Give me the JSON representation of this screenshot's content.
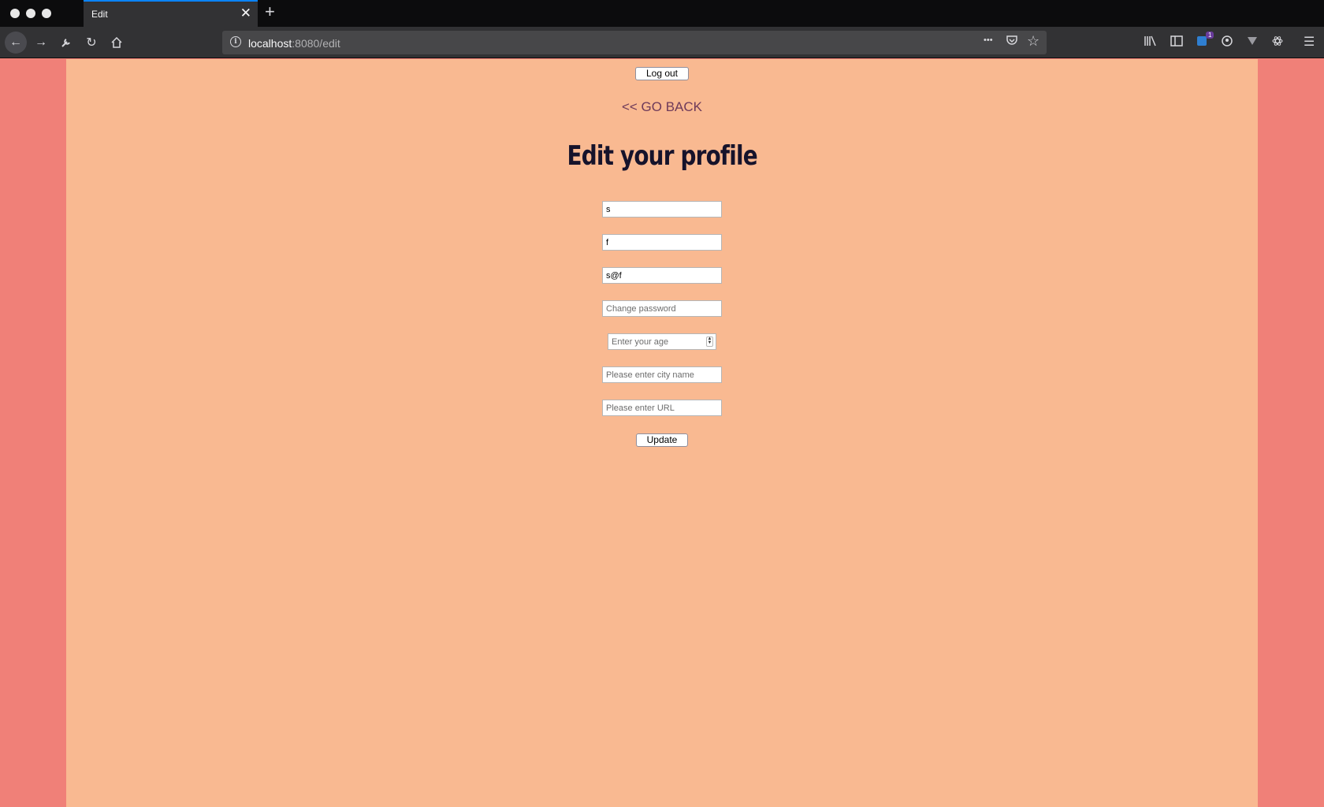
{
  "browser": {
    "tab_title": "Edit",
    "tab_close": "✕",
    "new_tab": "+",
    "url_host": "localhost",
    "url_rest": ":8080/edit",
    "more": "•••",
    "badge_count": "1",
    "accent_color": "#0a84ff"
  },
  "page": {
    "logout_label": "Log out",
    "go_back_label": "<< GO BACK",
    "heading": "Edit your profile",
    "fields": {
      "first_name_value": "s",
      "last_name_value": "f",
      "email_value": "s@f",
      "password_placeholder": "Change password",
      "age_placeholder": "Enter your age",
      "city_placeholder": "Please enter city name",
      "url_placeholder": "Please enter URL"
    },
    "update_label": "Update",
    "colors": {
      "side_background": "#f08078",
      "main_background": "#f9b991",
      "heading_color": "#16132b",
      "link_color": "#6e3a5a"
    }
  }
}
